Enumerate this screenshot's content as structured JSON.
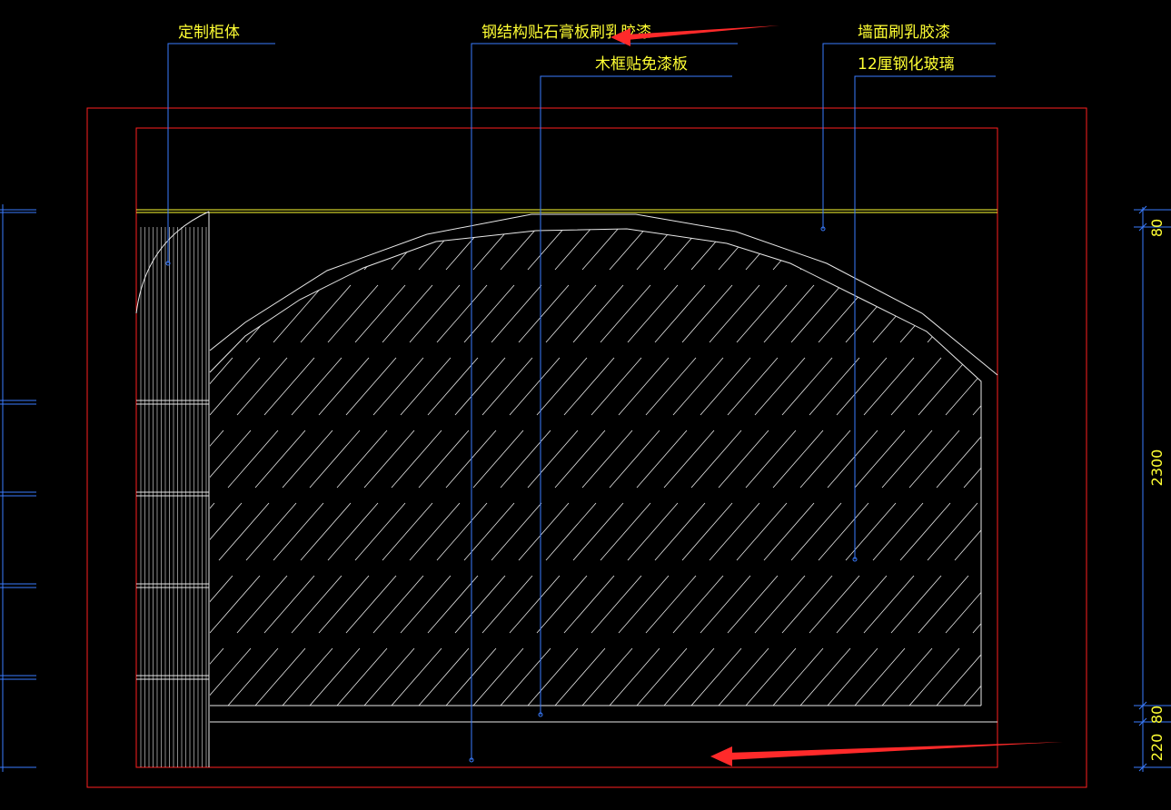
{
  "drawing": {
    "colors": {
      "background": "#000000",
      "frame": "#ff2020",
      "leader": "#3a7cff",
      "text": "#ffff33",
      "linework": "#e8e8e8",
      "ceiling_line": "#ffff33",
      "arrow": "#ff2a2a"
    },
    "labels": {
      "custom_cabinet": "定制柜体",
      "steel_gypsum": "钢结构贴石膏板刷乳胶漆",
      "wood_frame": "木框贴免漆板",
      "wall_paint": "墙面刷乳胶漆",
      "tempered_glass": "12厘钢化玻璃"
    },
    "dimensions": {
      "top": "80",
      "middle": "2300",
      "bottom_a": "80",
      "bottom_b": "220"
    }
  }
}
